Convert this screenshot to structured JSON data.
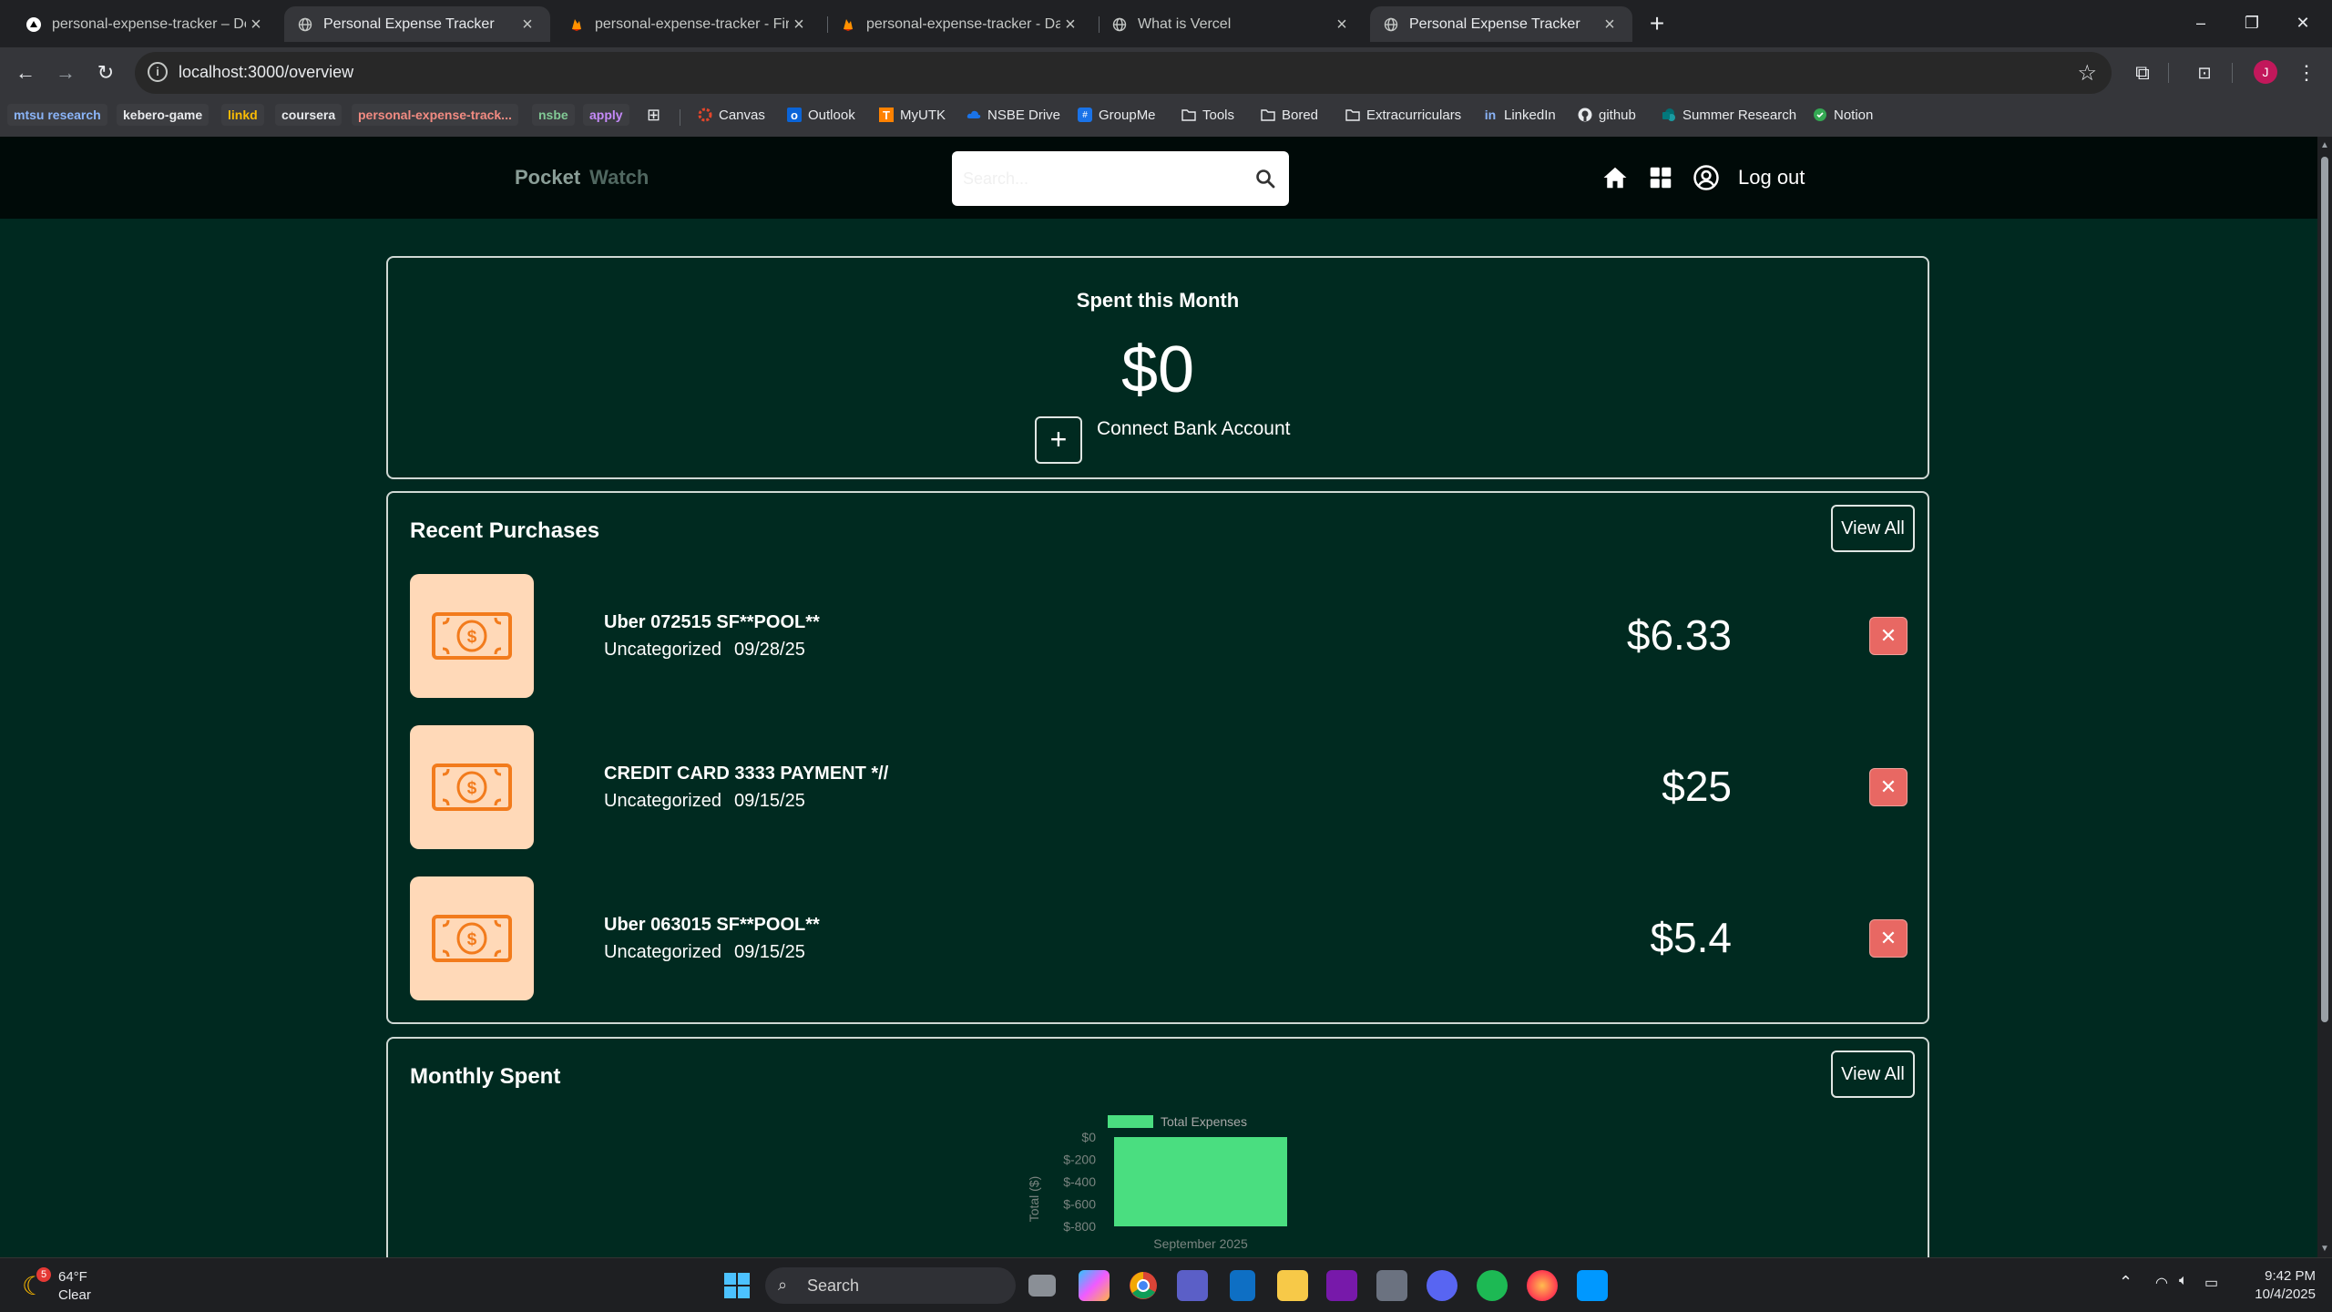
{
  "browser": {
    "tabs": [
      {
        "title": "personal-expense-tracker – Dep",
        "favicon": "vercel-icon",
        "active": false
      },
      {
        "title": "Personal Expense Tracker",
        "favicon": "globe-icon",
        "active": true
      },
      {
        "title": "personal-expense-tracker - Fire",
        "favicon": "firebase-icon",
        "active": false
      },
      {
        "title": "personal-expense-tracker - Dat",
        "favicon": "firebase-icon",
        "active": false
      },
      {
        "title": "What is Vercel",
        "favicon": "globe-icon",
        "active": false
      },
      {
        "title": "Personal Expense Tracker",
        "favicon": "globe-icon",
        "active": true
      }
    ],
    "url": "localhost:3000/overview",
    "profile_initial": "J",
    "bookmarks_pills": [
      {
        "label": "mtsu research",
        "color": "#8ab4f8"
      },
      {
        "label": "kebero-game",
        "color": "#e8eaed"
      },
      {
        "label": "linkd",
        "color": "#fbbc04"
      },
      {
        "label": "coursera",
        "color": "#e8eaed"
      },
      {
        "label": "personal-expense-track...",
        "color": "#f28b82"
      },
      {
        "label": "nsbe",
        "color": "#81c995"
      },
      {
        "label": "apply",
        "color": "#c58af9"
      }
    ],
    "bookmarks": [
      {
        "label": "Canvas",
        "icon": "canvas-icon"
      },
      {
        "label": "Outlook",
        "icon": "outlook-icon"
      },
      {
        "label": "MyUTK",
        "icon": "utk-icon"
      },
      {
        "label": "NSBE Drive",
        "icon": "onedrive-icon"
      },
      {
        "label": "GroupMe",
        "icon": "groupme-icon"
      },
      {
        "label": "Tools",
        "icon": "folder-icon"
      },
      {
        "label": "Bored",
        "icon": "folder-icon"
      },
      {
        "label": "Extracurriculars",
        "icon": "folder-icon"
      },
      {
        "label": "LinkedIn",
        "icon": "linkedin-icon"
      },
      {
        "label": "github",
        "icon": "github-icon"
      },
      {
        "label": "Summer Research",
        "icon": "sharepoint-icon"
      },
      {
        "label": "Notion",
        "icon": "notion-icon"
      }
    ]
  },
  "app": {
    "brand_first": "Pocket",
    "brand_second": "Watch",
    "search_placeholder": "Search...",
    "logout_label": "Log out",
    "summary": {
      "title": "Spent this Month",
      "amount": "$0",
      "connect_label": "Connect Bank Account",
      "plus": "+"
    },
    "recent": {
      "title": "Recent Purchases",
      "view_all": "View All",
      "items": [
        {
          "name": "Uber 072515 SF**POOL**",
          "category": "Uncategorized",
          "date": "09/28/25",
          "amount": "$6.33"
        },
        {
          "name": "CREDIT CARD 3333 PAYMENT *//",
          "category": "Uncategorized",
          "date": "09/15/25",
          "amount": "$25"
        },
        {
          "name": "Uber 063015 SF**POOL**",
          "category": "Uncategorized",
          "date": "09/15/25",
          "amount": "$5.4"
        }
      ]
    },
    "monthly": {
      "title": "Monthly Spent",
      "view_all": "View All"
    }
  },
  "chart_data": {
    "type": "bar",
    "categories": [
      "September 2025"
    ],
    "series": [
      {
        "name": "Total Expenses",
        "values": [
          -800
        ],
        "color": "#4ade80"
      }
    ],
    "ylabel": "Total ($)",
    "yticks": [
      "$0",
      "$-200",
      "$-400",
      "$-600",
      "$-800"
    ],
    "ylim": [
      -800,
      0
    ],
    "legend": "top"
  },
  "taskbar": {
    "weather_temp": "64°F",
    "weather_desc": "Clear",
    "weather_badge": "5",
    "search_label": "Search",
    "time": "9:42 PM",
    "date": "10/4/2025"
  }
}
